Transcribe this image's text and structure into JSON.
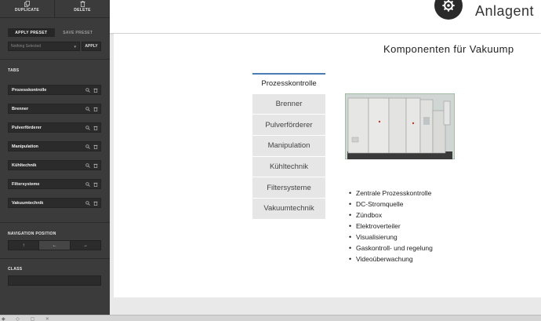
{
  "sidebar": {
    "top_actions": [
      {
        "label": "DUPLICATE",
        "icon": "copy-icon"
      },
      {
        "label": "DELETE",
        "icon": "trash-icon"
      }
    ],
    "preset_tabs": {
      "apply": "APPLY PRESET",
      "save": "SAVE PRESET"
    },
    "preset_select": {
      "value": "Nothing Selected"
    },
    "apply_button": "APPLY",
    "tabs_title": "TABS",
    "tab_items": [
      {
        "label": "Prozesskontrolle"
      },
      {
        "label": "Brenner"
      },
      {
        "label": "Pulverförderer"
      },
      {
        "label": "Manipulation"
      },
      {
        "label": "Kühltechnik"
      },
      {
        "label": "Filtersysteme"
      },
      {
        "label": "Vakuumtechnik"
      }
    ],
    "nav_position_title": "NAVIGATION POSITION",
    "nav_buttons": [
      {
        "glyph": "↑",
        "icon": "arrow-up-icon"
      },
      {
        "glyph": "←",
        "icon": "arrow-left-icon",
        "active": true
      },
      {
        "glyph": "→",
        "icon": "arrow-right-icon"
      }
    ],
    "class_title": "CLASS",
    "class_value": ""
  },
  "header": {
    "site_title": "Anlagent",
    "logo_icon": "gear-logo-icon"
  },
  "main": {
    "heading": "Komponenten für Vakuump",
    "vertical_tabs": [
      "Prozesskontrolle",
      "Brenner",
      "Pulverförderer",
      "Manipulation",
      "Kühltechnik",
      "Filtersysteme",
      "Vakuumtechnik"
    ],
    "active_tab_index": 0,
    "features": [
      "Zentrale Prozesskontrolle",
      "DC-Stromquelle",
      "Zündbox",
      "Elektroverteiler",
      "Visualisierung",
      "Gaskontroll- und regelung",
      "Videoüberwachung"
    ]
  },
  "colors": {
    "sidebar_bg": "#3b3b3b",
    "active_tab_border": "#4a7cb8",
    "tab_bg": "#e6e6e6"
  }
}
